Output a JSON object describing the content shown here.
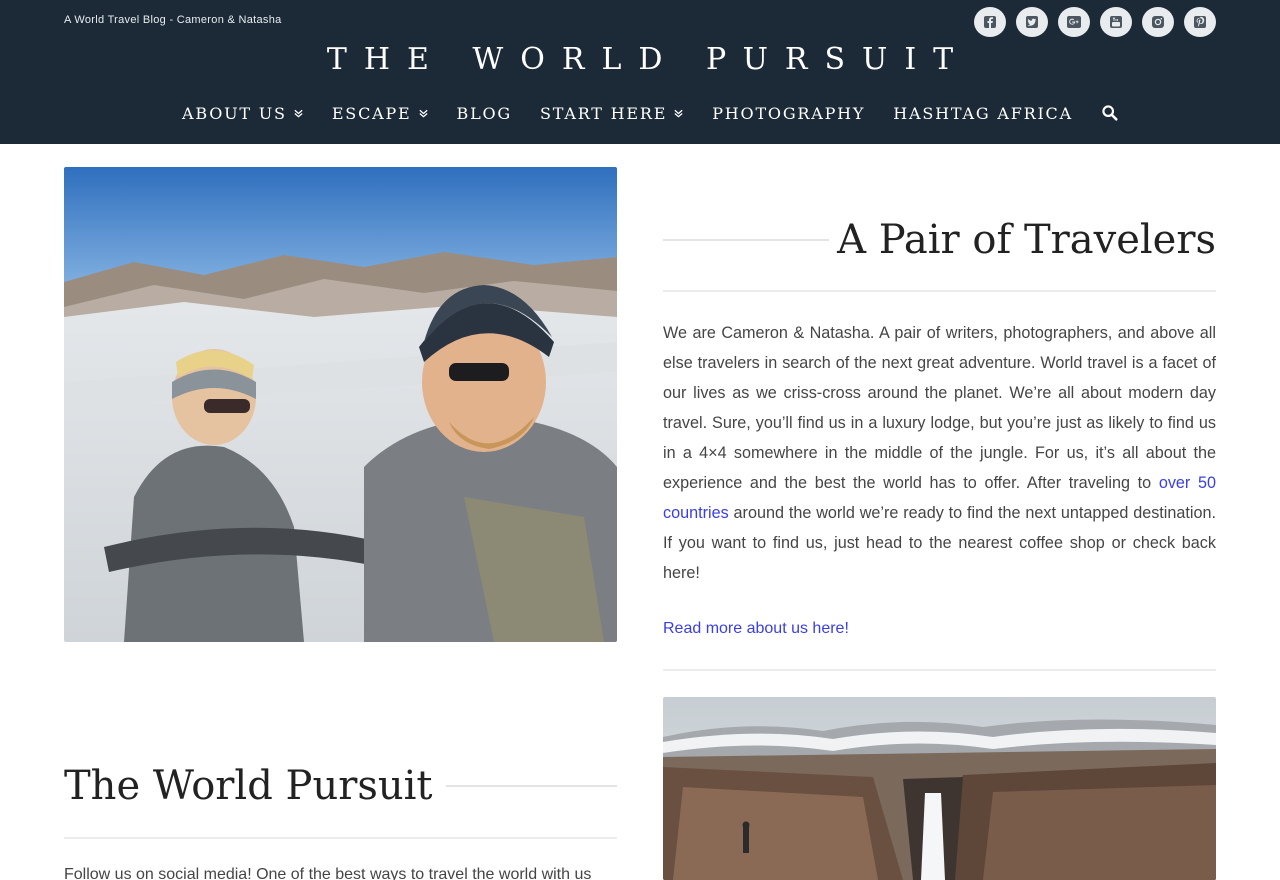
{
  "header": {
    "tagline": "A World Travel Blog - Cameron & Natasha",
    "brand": "THE WORLD PURSUIT",
    "social": [
      {
        "name": "facebook-icon"
      },
      {
        "name": "twitter-icon"
      },
      {
        "name": "google-plus-icon"
      },
      {
        "name": "youtube-icon"
      },
      {
        "name": "instagram-icon"
      },
      {
        "name": "pinterest-icon"
      }
    ],
    "nav": [
      {
        "label": "ABOUT US",
        "dropdown": true
      },
      {
        "label": "ESCAPE",
        "dropdown": true
      },
      {
        "label": "BLOG",
        "dropdown": false
      },
      {
        "label": "START HERE",
        "dropdown": true
      },
      {
        "label": "PHOTOGRAPHY",
        "dropdown": false
      },
      {
        "label": "HASHTAG AFRICA",
        "dropdown": false
      }
    ]
  },
  "about": {
    "heading": "A Pair of Travelers",
    "paragraph_before_link": "We are Cameron & Natasha. A pair of writers, photographers, and above all else travelers in search of the next great adventure. World travel is a facet of our lives as we criss-cross around the planet. We’re all about modern day travel. Sure, you’ll find us in a luxury lodge, but you’re just as likely to find us in a 4×4 somewhere in the middle of the jungle. For us, it’s all about the experience and the best the world has to offer. After traveling to ",
    "link_text": "over 50 countries",
    "paragraph_after_link": " around the world we’re ready to find the next untapped destination. If you want to find us, just head to the nearest coffee shop or check back here!",
    "read_more": "Read more about us here!"
  },
  "pursuit": {
    "heading": "The World Pursuit",
    "follow_text": "Follow us on social media! One of the best ways to travel the world with us"
  },
  "colors": {
    "header_bg": "#1c2a38",
    "link": "#3b3fe0",
    "heading_text": "#222222"
  }
}
